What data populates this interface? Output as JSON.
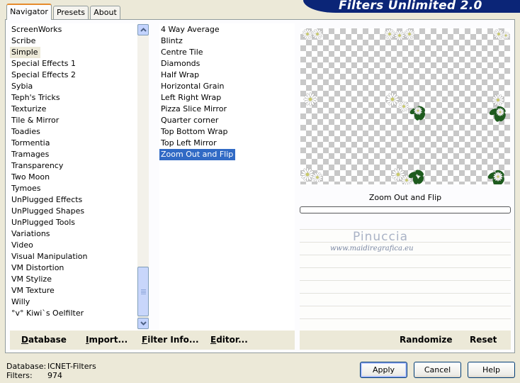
{
  "tabs": [
    {
      "label": "Navigator",
      "active": true
    },
    {
      "label": "Presets",
      "active": false
    },
    {
      "label": "About",
      "active": false
    }
  ],
  "banner": {
    "title": "Filters Unlimited 2.0"
  },
  "categories": {
    "items": [
      "ScreenWorks",
      "Scribe",
      "Simple",
      "Special Effects 1",
      "Special Effects 2",
      "Sybia",
      "Teph's Tricks",
      "Texturize",
      "Tile & Mirror",
      "Toadies",
      "Tormentia",
      "Tramages",
      "Transparency",
      "Two Moon",
      "Tymoes",
      "UnPlugged Effects",
      "UnPlugged Shapes",
      "UnPlugged Tools",
      "Variations",
      "Video",
      "Visual Manipulation",
      "VM Distortion",
      "VM Stylize",
      "VM Texture",
      "Willy",
      "°v° Kiwi`s Oelfilter"
    ],
    "selected": "Simple"
  },
  "filters": {
    "items": [
      "4 Way Average",
      "Blintz",
      "Centre Tile",
      "Diamonds",
      "Half Wrap",
      "Horizontal Grain",
      "Left Right Wrap",
      "Pizza Slice Mirror",
      "Quarter corner",
      "Top Bottom Wrap",
      "Top Left Mirror",
      "Zoom Out and Flip"
    ],
    "selected": "Zoom Out and Flip"
  },
  "preview": {
    "filter_name": "Zoom Out and Flip",
    "progress": 0
  },
  "watermark": {
    "name": "Pinuccia",
    "url": "www.maidiregrafica.eu"
  },
  "links": {
    "database": "Database",
    "import": "Import...",
    "filter_info": "Filter Info...",
    "editor": "Editor...",
    "randomize": "Randomize",
    "reset": "Reset"
  },
  "status": {
    "database_label": "Database:",
    "database_value": "ICNET-Filters",
    "filters_label": "Filters:",
    "filters_value": "974"
  },
  "buttons": {
    "apply": "Apply",
    "cancel": "Cancel",
    "help": "Help"
  },
  "colors": {
    "banner": "#0b2577",
    "selection": "#316ac5",
    "window": "#ece9d8"
  },
  "icons": {
    "scroll_up": "chevron-up-icon",
    "scroll_down": "chevron-down-icon",
    "scroll_grip": "grip-icon"
  }
}
